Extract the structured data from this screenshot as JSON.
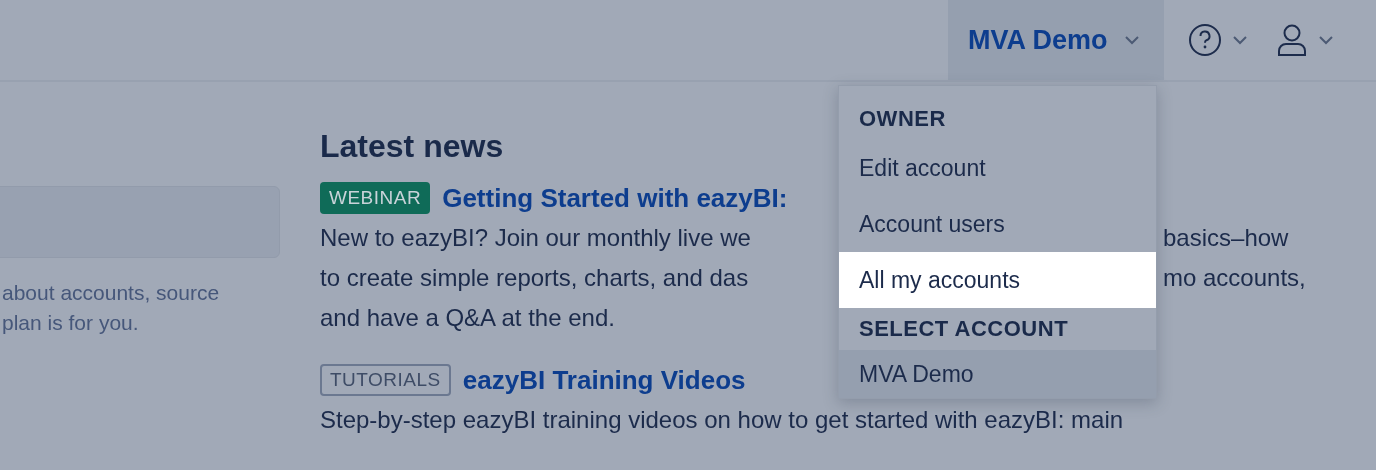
{
  "header": {
    "account_button": {
      "label": "MVA Demo",
      "expanded": true
    }
  },
  "account_menu": {
    "sections": [
      {
        "heading": "OWNER",
        "items": [
          {
            "label": "Edit account",
            "selected": false,
            "current": false
          },
          {
            "label": "Account users",
            "selected": false,
            "current": false
          },
          {
            "label": "All my accounts",
            "selected": true,
            "current": false
          }
        ]
      },
      {
        "heading": "SELECT ACCOUNT",
        "items": [
          {
            "label": "MVA Demo",
            "selected": false,
            "current": true
          }
        ]
      }
    ]
  },
  "sidebar": {
    "text_lines": [
      "about accounts, source",
      "plan is for you."
    ]
  },
  "news": {
    "title": "Latest news",
    "items": [
      {
        "badge": {
          "label": "WEBINAR",
          "kind": "filled"
        },
        "title": "Getting Started with eazyBI:",
        "lines": [
          [
            "New to eazyBI? Join our monthly live we",
            "basics–how"
          ],
          [
            "to create simple reports, charts, and das",
            "mo accounts,"
          ],
          [
            "and have a Q&A at the end."
          ]
        ]
      },
      {
        "badge": {
          "label": "TUTORIALS",
          "kind": "outlined"
        },
        "title": "eazyBI Training Videos",
        "lines": [
          [
            "Step-by-step eazyBI training videos on how to get started with eazyBI: main"
          ]
        ]
      }
    ]
  }
}
